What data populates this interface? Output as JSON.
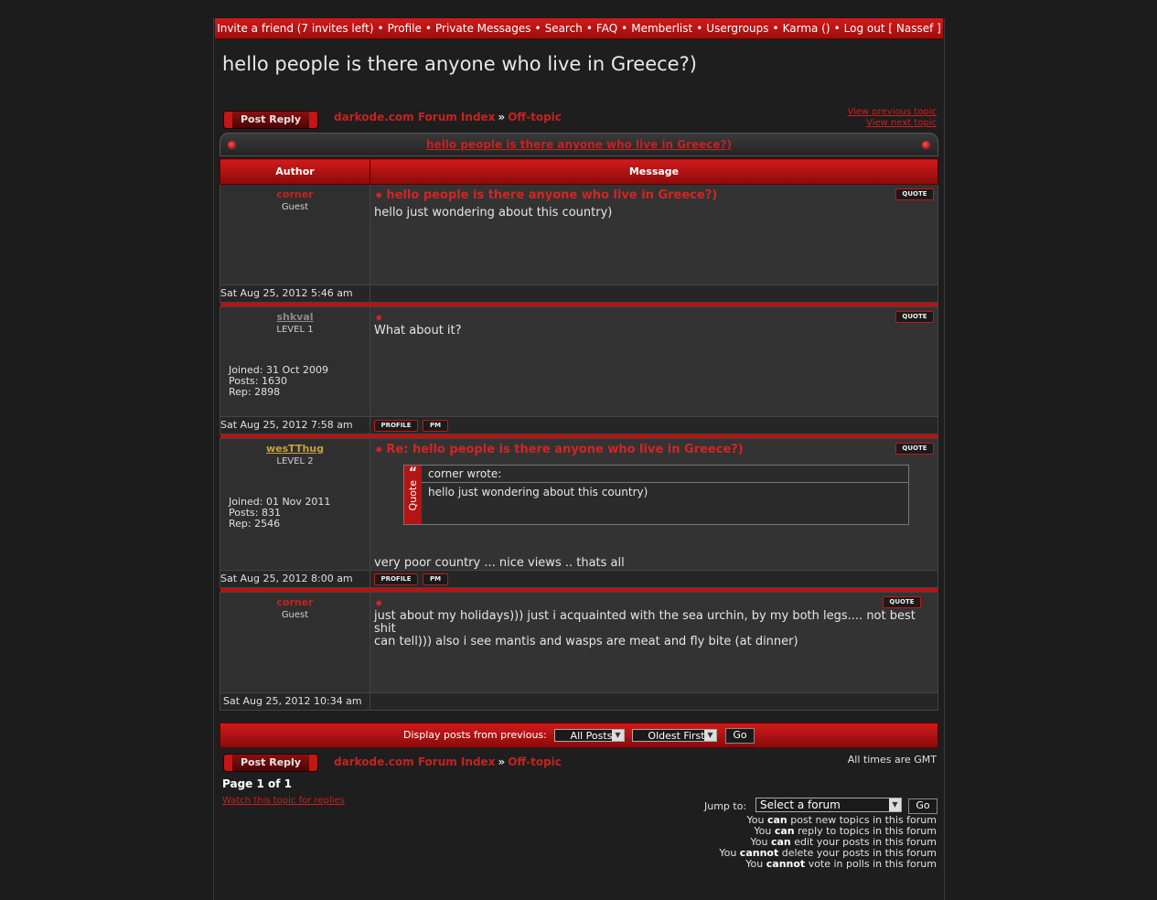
{
  "nav": {
    "items": [
      "Invite a friend (7 invites left)",
      "Profile",
      "Private Messages",
      "Search",
      "FAQ",
      "Memberlist",
      "Usergroups",
      "Karma ()",
      "Log out [ Nassef ]"
    ],
    "separator": "•"
  },
  "page_title": "hello people is there anyone who live in Greece?)",
  "post_reply_label": "Post Reply",
  "breadcrumb": {
    "index": "darkode.com Forum Index",
    "sep": "»",
    "forum": "Off-topic"
  },
  "topic_nav": {
    "previous": "View previous topic",
    "next": "View next topic"
  },
  "topic_bar_title": "hello people is there anyone who live in Greece?)",
  "table_headers": {
    "author": "Author",
    "message": "Message"
  },
  "posts": [
    {
      "author": "corner",
      "author_color": "#c62222",
      "rank": "Guest",
      "title": "hello people is there anyone who live in Greece?)",
      "body": "hello just wondering about this country)",
      "date": "Sat Aug 25, 2012 5:46 am"
    },
    {
      "author": "shkval",
      "author_color": "#8a8a8a",
      "rank": "LEVEL 1",
      "joined": "Joined: 31 Oct 2009",
      "posts": "Posts: 1630",
      "rep": "Rep: 2898",
      "title": "",
      "body": "What about it?",
      "date": "Sat Aug 25, 2012 7:58 am"
    },
    {
      "author": "wesTThug",
      "author_color": "#c8a040",
      "rank": "LEVEL 2",
      "joined": "Joined: 01 Nov 2011",
      "posts": "Posts: 831",
      "rep": "Rep: 2546",
      "title": "Re: hello people is there anyone who live in Greece?)",
      "quote_author": "corner wrote:",
      "quote_text": "hello just wondering about this country)",
      "quote_label": "Quote",
      "body": "very poor country ... nice views .. thats all",
      "date": "Sat Aug 25, 2012 8:00 am"
    },
    {
      "author": "corner",
      "author_color": "#c62222",
      "rank": "Guest",
      "title": "",
      "body_line1": "just about my holidays))) just i acquainted with the sea urchin, by my both legs.... not best shit",
      "body_line2": "can tell))) also i see mantis and wasps are meat and fly bite (at dinner)",
      "date": "Sat Aug 25, 2012 10:34 am"
    }
  ],
  "buttons": {
    "quote": "QUOTE",
    "profile": "PROFILE",
    "pm": "PM"
  },
  "display_posts": {
    "label": "Display posts from previous:",
    "filter_value": "All Posts",
    "order_value": "Oldest First",
    "go": "Go"
  },
  "timezone_note": "All times are GMT",
  "pagination": "Page 1 of 1",
  "watch_link": "Watch this topic for replies",
  "jump": {
    "label": "Jump to:",
    "value": "Select a forum",
    "go": "Go"
  },
  "permissions": [
    {
      "pre": "You",
      "key": "can",
      "post": "post new topics in this forum"
    },
    {
      "pre": "You",
      "key": "can",
      "post": "reply to topics in this forum"
    },
    {
      "pre": "You",
      "key": "can",
      "post": "edit your posts in this forum"
    },
    {
      "pre": "You",
      "key": "cannot",
      "post": "delete your posts in this forum"
    },
    {
      "pre": "You",
      "key": "cannot",
      "post": "vote in polls in this forum"
    }
  ],
  "colors": {
    "accent": "#c41616",
    "link": "#c62222",
    "background": "#1c1c1c"
  }
}
